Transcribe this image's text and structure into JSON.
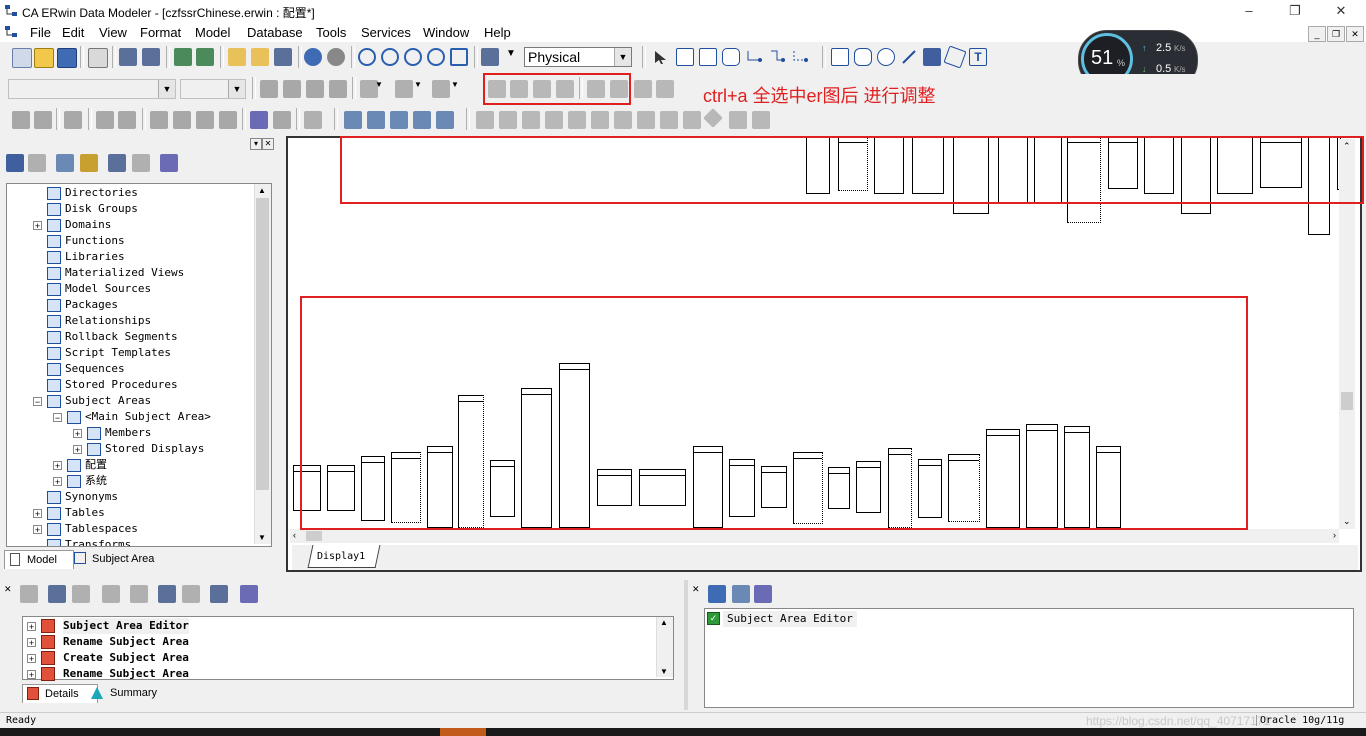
{
  "window": {
    "title": "CA ERwin Data Modeler - [czfssrChinese.erwin : 配置*]",
    "minimize": "–",
    "restore": "❐",
    "close": "✕"
  },
  "menu": [
    "File",
    "Edit",
    "View",
    "Format",
    "Model",
    "Database",
    "Tools",
    "Services",
    "Window",
    "Help"
  ],
  "toolbar": {
    "view_mode": "Physical"
  },
  "annotation": "ctrl+a 全选中er图后 进行调整",
  "speed_widget": {
    "percent": "51",
    "percent_unit": "%",
    "upload": "2.5",
    "upload_unit": "K/s",
    "download": "0.5",
    "download_unit": "K/s"
  },
  "tree": {
    "items": [
      {
        "label": "Directories",
        "indent": 1,
        "exp": ""
      },
      {
        "label": "Disk Groups",
        "indent": 1,
        "exp": ""
      },
      {
        "label": "Domains",
        "indent": 1,
        "exp": "+"
      },
      {
        "label": "Functions",
        "indent": 1,
        "exp": ""
      },
      {
        "label": "Libraries",
        "indent": 1,
        "exp": ""
      },
      {
        "label": "Materialized Views",
        "indent": 1,
        "exp": ""
      },
      {
        "label": "Model Sources",
        "indent": 1,
        "exp": ""
      },
      {
        "label": "Packages",
        "indent": 1,
        "exp": ""
      },
      {
        "label": "Relationships",
        "indent": 1,
        "exp": ""
      },
      {
        "label": "Rollback Segments",
        "indent": 1,
        "exp": ""
      },
      {
        "label": "Script Templates",
        "indent": 1,
        "exp": ""
      },
      {
        "label": "Sequences",
        "indent": 1,
        "exp": ""
      },
      {
        "label": "Stored Procedures",
        "indent": 1,
        "exp": ""
      },
      {
        "label": "Subject Areas",
        "indent": 1,
        "exp": "−"
      },
      {
        "label": "<Main Subject Area>",
        "indent": 2,
        "exp": "−"
      },
      {
        "label": "Members",
        "indent": 3,
        "exp": "+"
      },
      {
        "label": "Stored Displays",
        "indent": 3,
        "exp": "+"
      },
      {
        "label": "配置",
        "indent": 2,
        "exp": "+"
      },
      {
        "label": "系统",
        "indent": 2,
        "exp": "+"
      },
      {
        "label": "Synonyms",
        "indent": 1,
        "exp": ""
      },
      {
        "label": "Tables",
        "indent": 1,
        "exp": "+"
      },
      {
        "label": "Tablespaces",
        "indent": 1,
        "exp": "+"
      },
      {
        "label": "Transforms",
        "indent": 1,
        "exp": ""
      }
    ]
  },
  "left_tabs": {
    "model": "Model",
    "subject_area": "Subject Area"
  },
  "canvas_tab": "Display1",
  "bottom_left": {
    "rows": [
      "Subject Area Editor",
      "Rename Subject Area",
      "Create Subject Area",
      "Rename Subject Area"
    ],
    "tabs": {
      "details": "Details",
      "summary": "Summary"
    }
  },
  "bottom_right": {
    "rows": [
      "Subject Area Editor"
    ]
  },
  "status": {
    "left": "Ready",
    "right": "Oracle 10g/11g",
    "watermark": "https://blog.csdn.net/qq_40717171"
  }
}
